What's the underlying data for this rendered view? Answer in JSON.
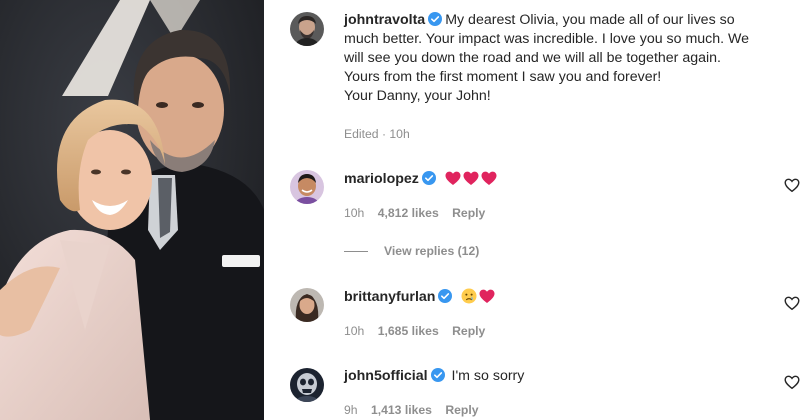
{
  "post": {
    "author": {
      "username": "johntravolta",
      "verified": true,
      "avatar_icon": "bearded-man-avatar"
    },
    "caption_lines": [
      "My dearest Olivia, you made all of our lives so",
      "much better. Your impact was incredible. I love you so much. We",
      "will see you down the road and we will all be together again.",
      "Yours from the first moment I saw you and forever!",
      "Your Danny, your John!"
    ],
    "edited_label": "Edited",
    "separator": "·",
    "time": "10h"
  },
  "comments": [
    {
      "username": "mariolopez",
      "verified": true,
      "text": "",
      "emojis": [
        "red-heart",
        "red-heart",
        "red-heart"
      ],
      "time": "10h",
      "likes": "4,812 likes",
      "reply_label": "Reply",
      "avatar_icon": "man-smiling-avatar",
      "view_replies": "View replies (12)"
    },
    {
      "username": "brittanyfurlan",
      "verified": true,
      "text": "",
      "emojis": [
        "crying-face",
        "red-heart"
      ],
      "time": "10h",
      "likes": "1,685 likes",
      "reply_label": "Reply",
      "avatar_icon": "woman-portrait-avatar"
    },
    {
      "username": "john5official",
      "verified": true,
      "text": "I'm so sorry",
      "emojis": [],
      "time": "9h",
      "likes": "1,413 likes",
      "reply_label": "Reply",
      "avatar_icon": "skull-mask-avatar"
    }
  ],
  "icons": {
    "verified_badge": "verified-badge-icon",
    "like": "heart-outline-icon"
  },
  "colors": {
    "verified_blue": "#3897f0",
    "heart_red": "#e0245e",
    "muted_text": "#8e8e8e",
    "text": "#262626"
  }
}
